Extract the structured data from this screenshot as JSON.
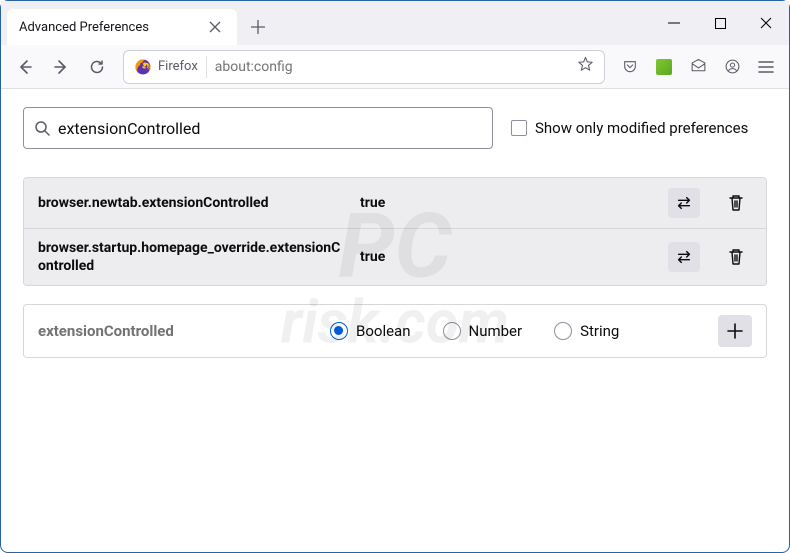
{
  "window": {
    "tab_title": "Advanced Preferences"
  },
  "toolbar": {
    "identity_label": "Firefox",
    "url": "about:config"
  },
  "content": {
    "search": {
      "value": "extensionControlled"
    },
    "filter_checkbox_label": "Show only modified preferences",
    "prefs": [
      {
        "name": "browser.newtab.extensionControlled",
        "value": "true"
      },
      {
        "name": "browser.startup.homepage_override.extensionControlled",
        "value": "true"
      }
    ],
    "new_pref": {
      "name": "extensionControlled",
      "types": [
        {
          "label": "Boolean",
          "selected": true
        },
        {
          "label": "Number",
          "selected": false
        },
        {
          "label": "String",
          "selected": false
        }
      ]
    }
  },
  "watermark": {
    "line1": "PC",
    "line2": "risk.com"
  }
}
